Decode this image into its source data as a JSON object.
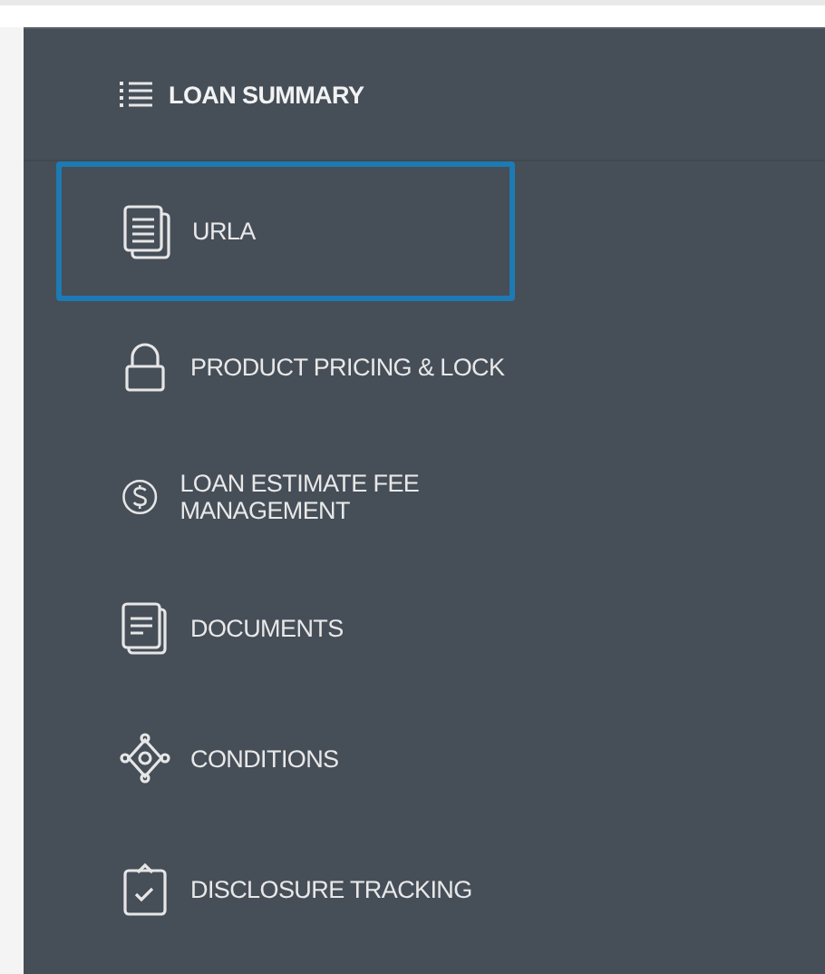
{
  "header": {
    "label": "LOAN SUMMARY"
  },
  "items": [
    {
      "kind": "urla",
      "label": "URLA",
      "selected": true
    },
    {
      "kind": "lock",
      "label": "PRODUCT PRICING & LOCK",
      "selected": false
    },
    {
      "kind": "fee",
      "label": "LOAN ESTIMATE FEE MANAGEMENT",
      "selected": false
    },
    {
      "kind": "documents",
      "label": "DOCUMENTS",
      "selected": false
    },
    {
      "kind": "conditions",
      "label": "CONDITIONS",
      "selected": false
    },
    {
      "kind": "disclosure",
      "label": "DISCLOSURE TRACKING",
      "selected": false
    }
  ]
}
